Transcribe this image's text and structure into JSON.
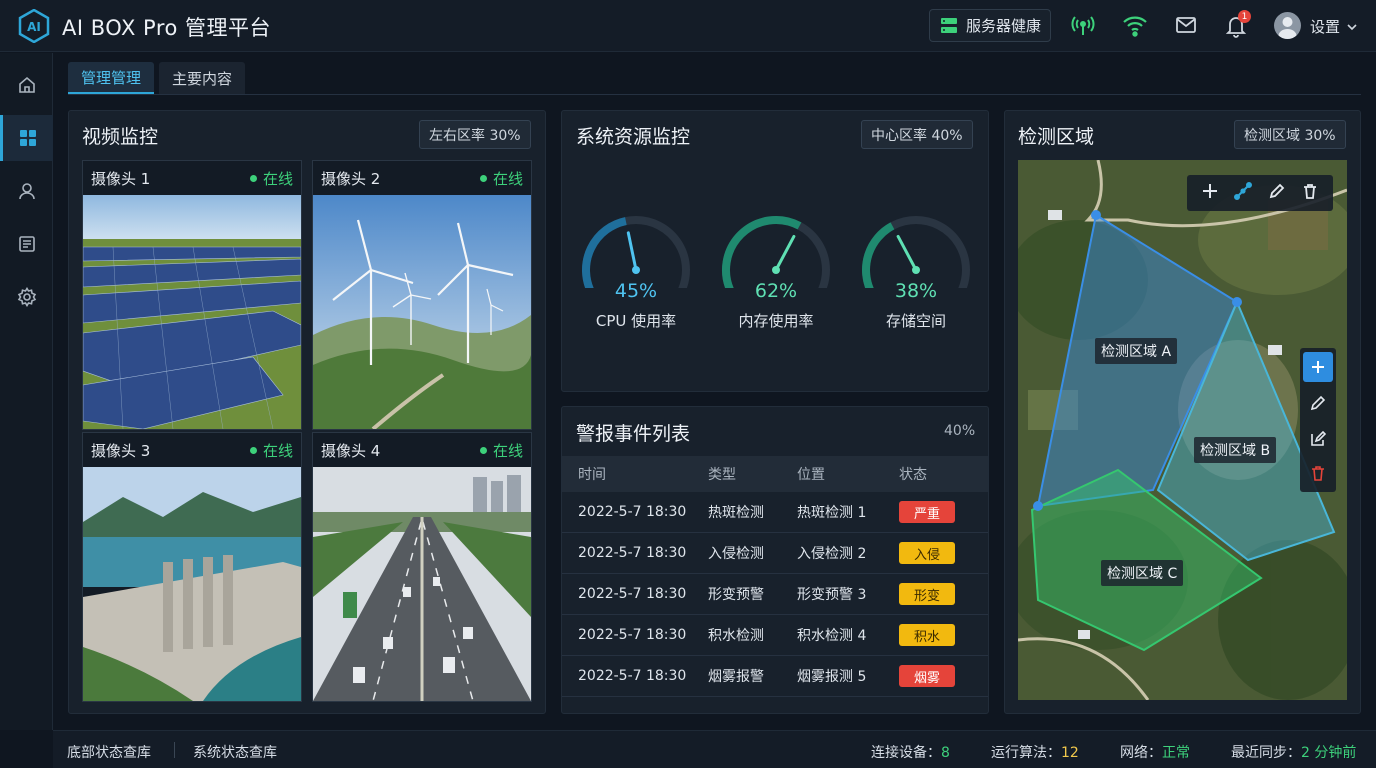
{
  "app": {
    "logo_text": "AI",
    "title": "AI BOX Pro 管理平台"
  },
  "topbar": {
    "server_health_label": "服务器健康",
    "notification_count": "1",
    "settings_label": "设置"
  },
  "tabs": [
    {
      "label": "管理管理",
      "active": true
    },
    {
      "label": "主要内容",
      "active": false
    }
  ],
  "video": {
    "title": "视频监控",
    "chip": "左右区率 30%",
    "cameras": [
      {
        "name": "摄像头 1",
        "status": "在线",
        "scene": "solar-panels"
      },
      {
        "name": "摄像头 2",
        "status": "在线",
        "scene": "wind-turbines"
      },
      {
        "name": "摄像头 3",
        "status": "在线",
        "scene": "dam"
      },
      {
        "name": "摄像头 4",
        "status": "在线",
        "scene": "highway"
      }
    ]
  },
  "resources": {
    "title": "系统资源监控",
    "chip": "中心区率 40%",
    "gauges": [
      {
        "value": "45%",
        "percent": 45,
        "label": "CPU 使用率"
      },
      {
        "value": "62%",
        "percent": 62,
        "label": "内存使用率"
      },
      {
        "value": "38%",
        "percent": 38,
        "label": "存储空间"
      }
    ]
  },
  "alerts": {
    "title": "警报事件列表",
    "percent": "40%",
    "columns": [
      "时间",
      "类型",
      "位置",
      "状态"
    ],
    "rows": [
      {
        "time": "2022-5-7 18:30",
        "type": "热斑检测",
        "location": "热斑检测 1",
        "status": "严重",
        "color": "#e5443a"
      },
      {
        "time": "2022-5-7 18:30",
        "type": "入侵检测",
        "location": "入侵检测 2",
        "status": "入侵",
        "color": "#f2b90f"
      },
      {
        "time": "2022-5-7 18:30",
        "type": "形变预警",
        "location": "形变预警 3",
        "status": "形变",
        "color": "#f2b90f"
      },
      {
        "time": "2022-5-7 18:30",
        "type": "积水检测",
        "location": "积水检测 4",
        "status": "积水",
        "color": "#f2b90f"
      },
      {
        "time": "2022-5-7 18:30",
        "type": "烟雾报警",
        "location": "烟雾报测 5",
        "status": "烟雾",
        "color": "#e5443a"
      }
    ]
  },
  "detection": {
    "title": "检测区域",
    "chip": "检测区域 30%",
    "zones": [
      {
        "label": "检测区域 A",
        "color": "#3a8ee6"
      },
      {
        "label": "检测区域 B",
        "color": "#49b6d8"
      },
      {
        "label": "检测区域 C",
        "color": "#35c76f"
      }
    ]
  },
  "footer": {
    "left_1": "底部状态查库",
    "left_2": "系统状态查库",
    "devices_label": "连接设备：",
    "devices_value": "8",
    "algos_label": "运行算法：",
    "algos_value": "12",
    "network_label": "网络：",
    "network_value": "正常",
    "sync_label": "最近同步：",
    "sync_value": "2 分钟前"
  },
  "colors": {
    "accent": "#2ea6d8",
    "online": "#3dd17b",
    "danger": "#e5443a",
    "warning": "#f2b90f"
  }
}
